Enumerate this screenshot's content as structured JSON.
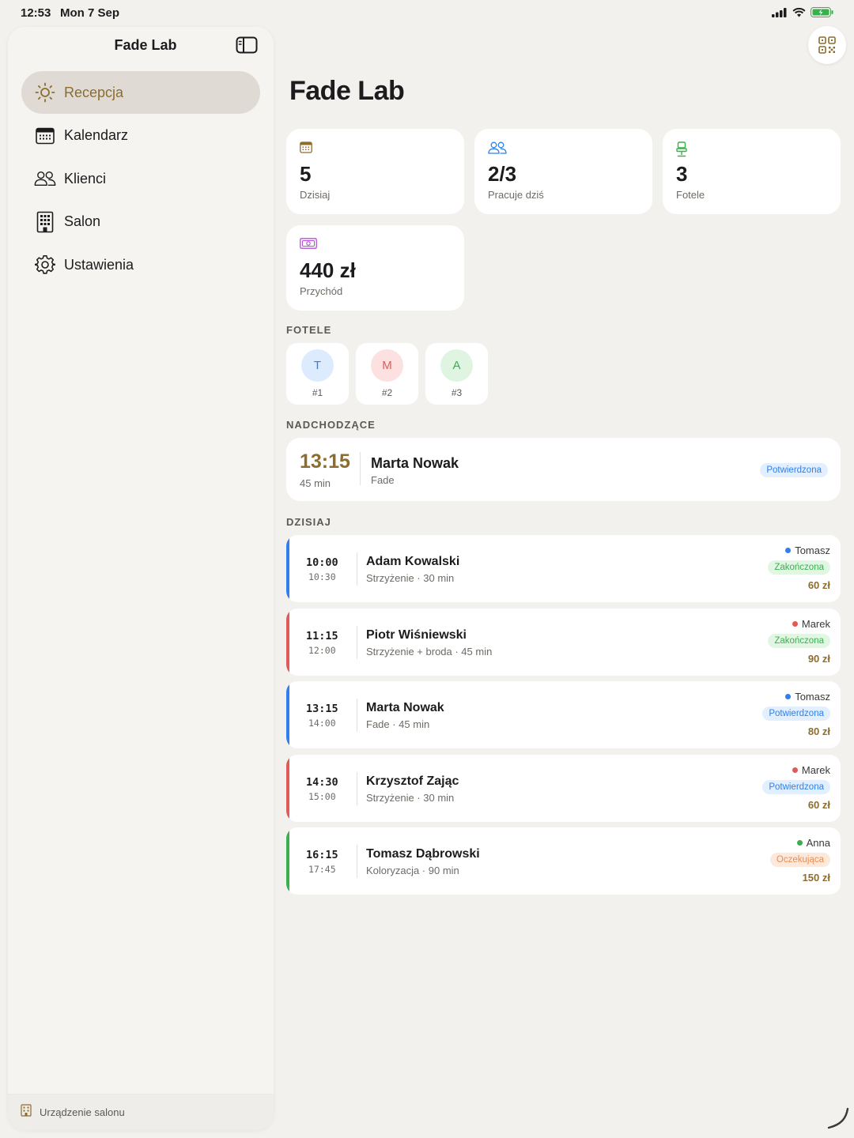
{
  "status_bar": {
    "time": "12:53",
    "date": "Mon 7 Sep"
  },
  "sidebar": {
    "title": "Fade Lab",
    "items": [
      {
        "label": "Recepcja",
        "icon": "sun-icon",
        "active": true
      },
      {
        "label": "Kalendarz",
        "icon": "calendar-icon"
      },
      {
        "label": "Klienci",
        "icon": "people-icon"
      },
      {
        "label": "Salon",
        "icon": "building-icon"
      },
      {
        "label": "Ustawienia",
        "icon": "gear-icon"
      }
    ],
    "footer": {
      "label": "Urządzenie salonu",
      "icon": "building-icon"
    }
  },
  "main": {
    "title": "Fade Lab",
    "stats": [
      {
        "value": "5",
        "label": "Dzisiaj",
        "icon": "calendar-icon",
        "color": "#8c6d2f"
      },
      {
        "value": "2/3",
        "label": "Pracuje dziś",
        "icon": "people-icon",
        "color": "#2f80ed"
      },
      {
        "value": "3",
        "label": "Fotele",
        "icon": "chair-icon",
        "color": "#3ab04d"
      },
      {
        "value": "440 zł",
        "label": "Przychód",
        "icon": "banknote-icon",
        "color": "#b84dd9"
      }
    ],
    "chairs_title": "FOTELE",
    "chairs": [
      {
        "initial": "T",
        "number": "#1",
        "color": "#2f80ed",
        "bg": "#dcebfd"
      },
      {
        "initial": "M",
        "number": "#2",
        "color": "#e05a5a",
        "bg": "#fde0e0"
      },
      {
        "initial": "A",
        "number": "#3",
        "color": "#3ab04d",
        "bg": "#dff5e2"
      }
    ],
    "upcoming_title": "NADCHODZĄCE",
    "upcoming": {
      "time": "13:15",
      "duration": "45 min",
      "name": "Marta Nowak",
      "service": "Fade",
      "status": "Potwierdzona"
    },
    "today_title": "DZISIAJ",
    "appointments": [
      {
        "start": "10:00",
        "end": "10:30",
        "name": "Adam Kowalski",
        "service": "Strzyżenie · 30 min",
        "barber": "Tomasz",
        "barber_color": "#2f80ed",
        "status": "Zakończona",
        "status_type": "done",
        "price": "60 zł",
        "bar_color": "#2f80ed"
      },
      {
        "start": "11:15",
        "end": "12:00",
        "name": "Piotr Wiśniewski",
        "service": "Strzyżenie + broda · 45 min",
        "barber": "Marek",
        "barber_color": "#e05a5a",
        "status": "Zakończona",
        "status_type": "done",
        "price": "90 zł",
        "bar_color": "#e05a5a"
      },
      {
        "start": "13:15",
        "end": "14:00",
        "name": "Marta Nowak",
        "service": "Fade · 45 min",
        "barber": "Tomasz",
        "barber_color": "#2f80ed",
        "status": "Potwierdzona",
        "status_type": "confirmed",
        "price": "80 zł",
        "bar_color": "#2f80ed"
      },
      {
        "start": "14:30",
        "end": "15:00",
        "name": "Krzysztof Zając",
        "service": "Strzyżenie · 30 min",
        "barber": "Marek",
        "barber_color": "#e05a5a",
        "status": "Potwierdzona",
        "status_type": "confirmed",
        "price": "60 zł",
        "bar_color": "#e05a5a"
      },
      {
        "start": "16:15",
        "end": "17:45",
        "name": "Tomasz Dąbrowski",
        "service": "Koloryzacja · 90 min",
        "barber": "Anna",
        "barber_color": "#3ab04d",
        "status": "Oczekująca",
        "status_type": "pending",
        "price": "150 zł",
        "bar_color": "#3ab04d"
      }
    ]
  }
}
